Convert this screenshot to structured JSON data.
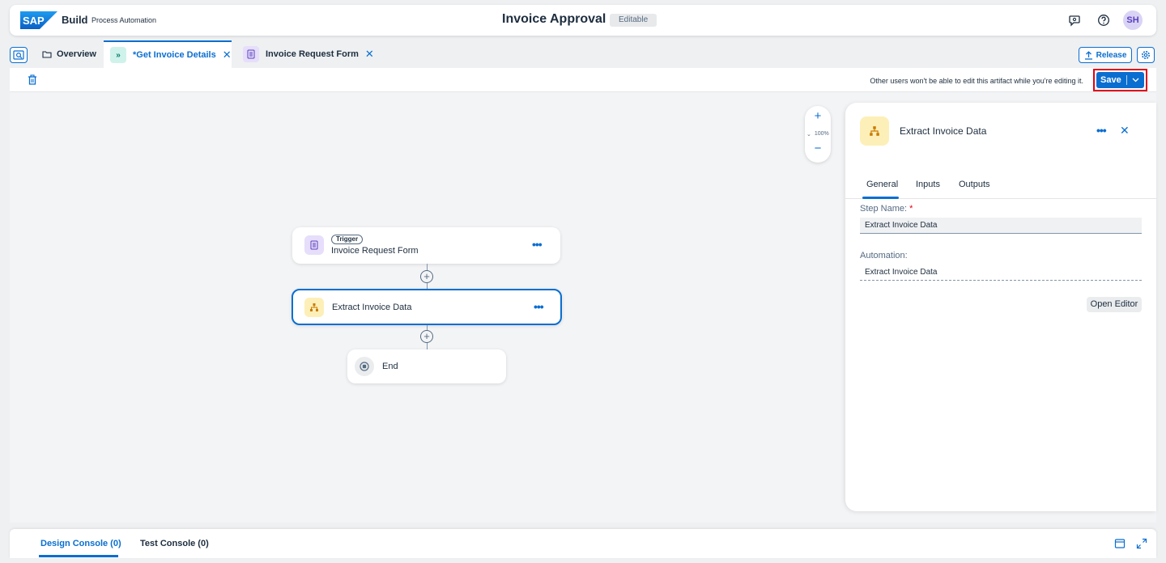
{
  "shell": {
    "logo_text": "SAP",
    "brand": "Build",
    "brand_sub": "Process Automation",
    "title": "Invoice Approval",
    "badge": "Editable",
    "avatar_initials": "SH"
  },
  "tabs": {
    "overview": "Overview",
    "active_tab": "*Get Invoice Details",
    "form_tab": "Invoice Request Form",
    "release_label": "Release"
  },
  "toolbar": {
    "message": "Other users won't be able to edit this artifact while you're editing it.",
    "save_label": "Save"
  },
  "canvas": {
    "zoom_level": "100%",
    "nodes": {
      "trigger_badge": "Trigger",
      "trigger_title": "Invoice Request Form",
      "step_title": "Extract Invoice Data",
      "end_title": "End"
    }
  },
  "panel": {
    "title": "Extract Invoice Data",
    "tabs": [
      "General",
      "Inputs",
      "Outputs"
    ],
    "step_name_label": "Step Name:",
    "step_name_required": "*",
    "step_name_value": "Extract Invoice Data",
    "automation_label": "Automation:",
    "automation_value": "Extract Invoice Data",
    "open_editor_label": "Open Editor"
  },
  "console": {
    "tabs": [
      "Design Console (0)",
      "Test Console (0)"
    ]
  },
  "colors": {
    "accent": "#0a6ed1",
    "highlight_border": "#e0001a",
    "automation_icon_bg": "#fdefb8",
    "form_icon_bg": "#e6defa"
  }
}
